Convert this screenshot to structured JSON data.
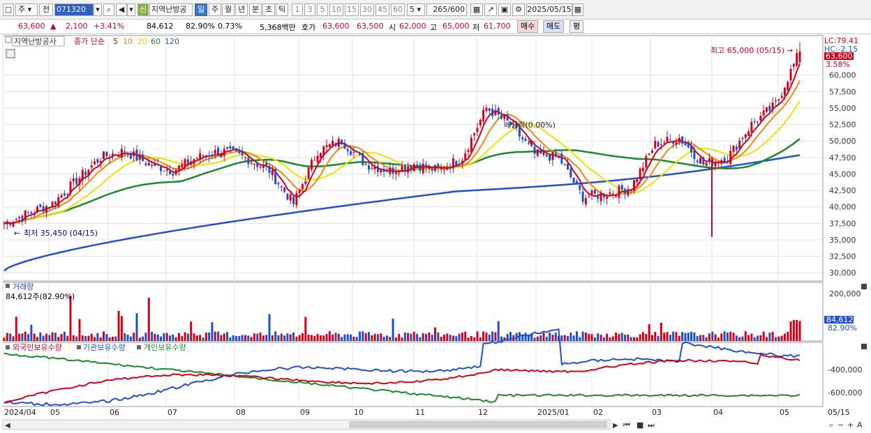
{
  "toolbar": {
    "market": "주",
    "prev": "전",
    "code": "071320",
    "name": "지역난방공",
    "new_badge": "신",
    "periods": [
      "일",
      "주",
      "월",
      "년",
      "분",
      "초",
      "틱"
    ],
    "active_period": "일",
    "intervals": [
      "1",
      "3",
      "5",
      "10",
      "15",
      "30",
      "45",
      "60"
    ],
    "interval_value": "5",
    "count": "265",
    "count_total": "/600",
    "date": "2025/05/15"
  },
  "quote": {
    "price": "63,600",
    "arrow": "▲",
    "change": "2,100",
    "change_pct": "+3.41%",
    "volume": "84,612",
    "vol_ratio": "82.90%",
    "turnover_pct": "0.73%",
    "amount": "5,368백만",
    "bid_label": "호가",
    "ask": "63,600",
    "bid": "63,500",
    "open_label": "시",
    "open": "62,000",
    "high_label": "고",
    "high": "65,000",
    "low_label": "저",
    "low": "61,700",
    "buy_label": "매수",
    "sell_label": "매도",
    "eval_label": "평"
  },
  "price_panel": {
    "title": "지역난방공사",
    "ma_label": "종가 단순",
    "ma_periods": [
      "5",
      "10",
      "20",
      "60",
      "120"
    ],
    "ma_colors": [
      "#d0021b",
      "#f08a00",
      "#f0e000",
      "#1a8a2a",
      "#2050d0"
    ],
    "high_annot": "최고 65,000 (05/15)",
    "low_annot": "최저 35,450 (04/15)",
    "dividend_annot": "배당락(0.00%)",
    "lc": "LC:79.41",
    "hc": "HC:-2.15",
    "last_price": "63,600",
    "last_pct": "3.58%",
    "y_ticks": [
      "60,000",
      "57,500",
      "55,000",
      "52,500",
      "50,000",
      "47,500",
      "45,000",
      "42,500",
      "40,000",
      "37,500",
      "35,000",
      "32,500",
      "30,000"
    ]
  },
  "volume_panel": {
    "title": "거래량",
    "value_text": "84,612주(82.90%)",
    "y_ticks": [
      "200,000",
      "100,000"
    ],
    "last_value": "84,612",
    "last_pct": "82.90%"
  },
  "holding_panel": {
    "legend": [
      "외국인보유수량",
      "기관보유수량",
      "개인보유수량"
    ],
    "colors": [
      "#d0021b",
      "#2050d0",
      "#1a8a2a"
    ],
    "y_ticks": [
      "-400,000",
      "-600,000"
    ]
  },
  "x_axis": [
    "2024/04",
    "05",
    "06",
    "07",
    "08",
    "09",
    "10",
    "11",
    "12",
    "2025/01",
    "02",
    "03",
    "04",
    "05",
    "05/15"
  ],
  "chart_data": {
    "type": "candlestick",
    "y_range": [
      28750,
      66000
    ],
    "x_labels": [
      "2024/04",
      "05",
      "06",
      "07",
      "08",
      "09",
      "10",
      "11",
      "12",
      "2025/01",
      "02",
      "03",
      "04",
      "05"
    ],
    "close_series_approx": [
      37500,
      39000,
      40500,
      44000,
      47500,
      48500,
      46500,
      45500,
      47500,
      48500,
      47500,
      45500,
      40500,
      48500,
      50000,
      46500,
      45500,
      46500,
      45500,
      47500,
      55000,
      52500,
      48000,
      47500,
      41500,
      42000,
      43000,
      49500,
      50500,
      46500,
      47500,
      52500,
      55500,
      63600
    ],
    "ma_series": [
      "5",
      "10",
      "20",
      "60",
      "120"
    ],
    "high": 65000,
    "low": 35450,
    "volume_range": [
      0,
      200000
    ]
  }
}
